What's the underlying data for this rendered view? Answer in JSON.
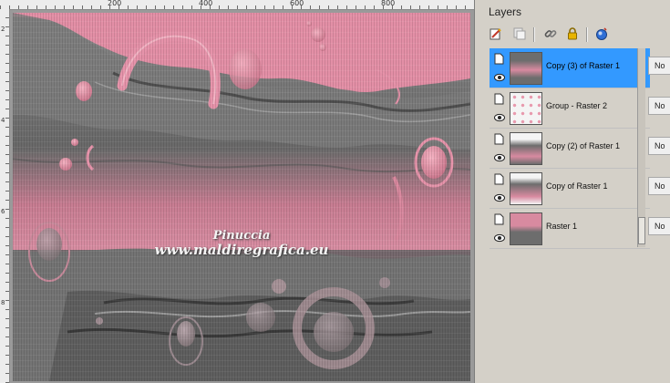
{
  "ruler": {
    "top_labels": [
      "200",
      "400",
      "600",
      "800"
    ],
    "left_labels": [
      "2",
      "4",
      "6",
      "8"
    ]
  },
  "canvas": {
    "watermark_line1": "Pinuccia",
    "watermark_line2": "www.maldiregrafica.eu",
    "colors": {
      "pink": "#e28ea4",
      "gray": "#6e6e6e",
      "dark_gray": "#4a4a4a"
    }
  },
  "layers_panel": {
    "title": "Layers",
    "toolbar_icons": [
      "new-layer-icon",
      "duplicate-layer-icon",
      "link-icon",
      "lock-icon",
      "mask-icon"
    ],
    "selected_color": "#3399ff",
    "layers": [
      {
        "name": "Copy (3) of Raster 1",
        "blend": "No",
        "selected": true
      },
      {
        "name": "Group - Raster 2",
        "blend": "No",
        "selected": false
      },
      {
        "name": "Copy (2) of Raster 1",
        "blend": "No",
        "selected": false
      },
      {
        "name": "Copy of Raster 1",
        "blend": "No",
        "selected": false
      },
      {
        "name": "Raster 1",
        "blend": "No",
        "selected": false
      }
    ]
  }
}
